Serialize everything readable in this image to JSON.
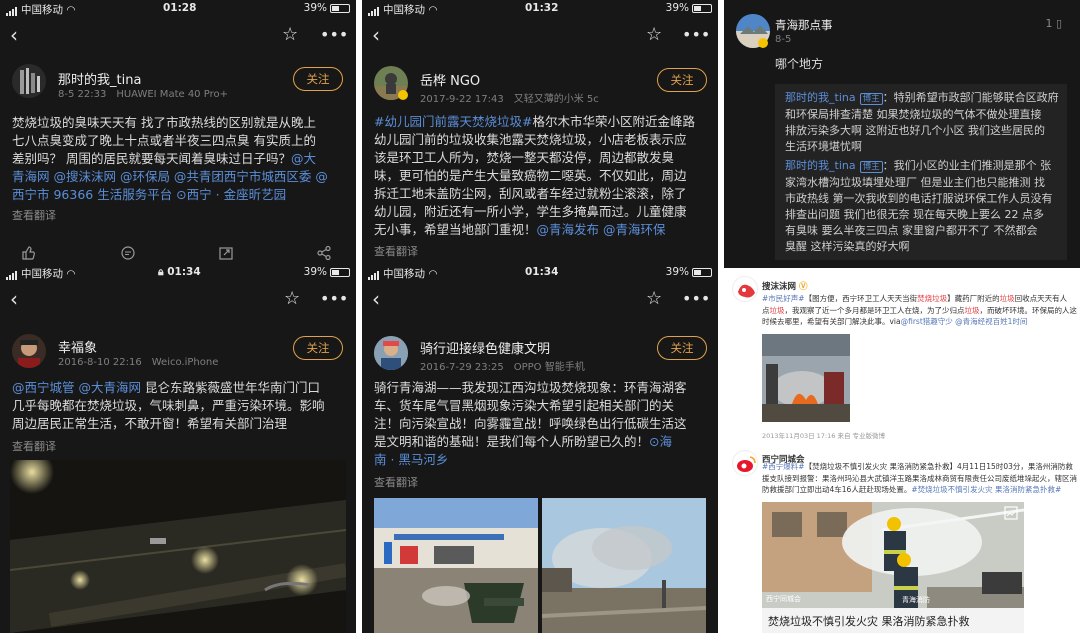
{
  "panel1": {
    "status": {
      "carrier": "中国移动",
      "time": "01:28",
      "battery": "39%"
    },
    "user": {
      "name": "那时的我_tina",
      "time": "8-5 22:33",
      "device": "HUAWEI Mate 40 Pro+"
    },
    "follow_label": "关注",
    "lines": [
      [
        {
          "t": "焚烧垃圾的臭味天天有 找了市政热线的区别就是从晚上"
        }
      ],
      [
        {
          "t": "七八点臭变成了晚上十点或者半夜三四点臭   有实质上的"
        }
      ],
      [
        {
          "t": "差别吗？ 周围的居民就要每天闻着臭味过日子吗？"
        },
        {
          "t": "@大",
          "link": true
        }
      ],
      [
        {
          "t": "青海网 @搜沫沫网 @环保局 @共青团西宁市城西区委 @",
          "link": true
        }
      ],
      [
        {
          "t": "西宁市 96366 生活服务平台 ⊙西宁 · 金座昕艺园",
          "link": true
        }
      ]
    ],
    "translate": "查看翻译"
  },
  "panel2": {
    "status": {
      "carrier": "中国移动",
      "time": "01:32",
      "battery": "39%"
    },
    "user": {
      "name": "岳桦 NGO",
      "time": "2017-9-22 17:43",
      "device": "又轻又薄的小米 5c"
    },
    "follow_label": "关注",
    "lines": [
      [
        {
          "t": "#幼儿园门前露天焚烧垃圾#",
          "link": true
        },
        {
          "t": "格尔木市华荣小区附近金峰路"
        }
      ],
      [
        {
          "t": "幼儿园门前的垃圾收集池露天焚烧垃圾，小店老板表示应"
        }
      ],
      [
        {
          "t": "该是环卫工人所为，焚烧一整天都没停，周边都散发臭"
        }
      ],
      [
        {
          "t": "味，更可怕的是产生大量致癌物二噁英。不仅如此，周边"
        }
      ],
      [
        {
          "t": "拆迁工地未盖防尘网，刮风或者车经过就粉尘滚滚，除了"
        }
      ],
      [
        {
          "t": "幼儿园，附近还有一所小学，学生多掩鼻而过。儿童健康"
        }
      ],
      [
        {
          "t": "无小事，希望当地部门重视！"
        },
        {
          "t": "@青海发布 @青海环保",
          "link": true
        }
      ]
    ],
    "translate": "查看翻译"
  },
  "panel3": {
    "user": {
      "name": "青海那点事",
      "date": "8-5"
    },
    "likes": "1",
    "question": "哪个地方",
    "replies": [
      {
        "author": "那时的我_tina",
        "badge": "博主",
        "lines": [
          "：特别希望市政部门能够联合区政府",
          "和环保局排查清楚  如果焚烧垃圾的气体不做处理直接",
          "排放污染多大啊  这附近也好几个小区  我们这些居民的",
          "生活环境堪忧啊"
        ]
      },
      {
        "author": "那时的我_tina",
        "badge": "博主",
        "lines": [
          "：我们小区的业主们推测是那个 张",
          "家湾水槽沟垃圾填埋处理厂   但是业主们也只能推测 找",
          "市政热线 第一次我收到的电话打服说环保工作人员没有",
          "排查出问题  我们也很无奈  现在每天晚上要么 22 点多",
          "有臭味 要么半夜三四点  家里窗户都开不了   不然都会",
          "臭醒 这样污染真的好大啊"
        ]
      }
    ]
  },
  "panel4": {
    "status": {
      "carrier": "中国移动",
      "time": "01:34",
      "battery": "39%"
    },
    "user": {
      "name": "幸福象",
      "time": "2016-8-10 22:16",
      "device": "Weico.iPhone"
    },
    "follow_label": "关注",
    "lines": [
      [
        {
          "t": "@西宁城管 @大青海网",
          "link": true
        },
        {
          "t": " 昆仑东路紫薇盛世年华南门门口"
        }
      ],
      [
        {
          "t": "几乎每晚都在焚烧垃圾，气味刺鼻，严重污染环境。影响"
        }
      ],
      [
        {
          "t": "周边居民正常生活，不敢开窗！希望有关部门治理"
        }
      ]
    ],
    "translate": "查看翻译"
  },
  "panel5": {
    "status": {
      "carrier": "中国移动",
      "time": "01:34",
      "battery": "39%"
    },
    "user": {
      "name": "骑行迎接绿色健康文明",
      "time": "2016-7-29 23:25",
      "device": "OPPO 智能手机"
    },
    "follow_label": "关注",
    "lines": [
      [
        {
          "t": "骑行青海湖——我发现江西沟垃圾焚烧现象：环青海湖客"
        }
      ],
      [
        {
          "t": "车、货车尾气冒黑烟现象污染大希望引起相关部门的关"
        }
      ],
      [
        {
          "t": "注！向污染宣战！向雾霾宣战！呼唤绿色出行低碳生活这"
        }
      ],
      [
        {
          "t": "是文明和谐的基础！是我们每个人所盼望已久的！"
        },
        {
          "t": "⊙海",
          "link": true
        }
      ],
      [
        {
          "t": "南 · 黑马河乡",
          "link": true
        }
      ]
    ],
    "translate": "查看翻译"
  },
  "panel6": {
    "post1": {
      "name": "搜沫沫网",
      "lines": [
        [
          {
            "t": "#市民好声#",
            "c": "blue"
          },
          {
            "t": "【图方便，西宁环卫工人天天当街"
          },
          {
            "t": "焚烧垃圾",
            "c": "red"
          },
          {
            "t": "】藏药厂附近的"
          },
          {
            "t": "垃圾",
            "c": "red"
          },
          {
            "t": "回收点天天有人"
          }
        ],
        [
          {
            "t": "点"
          },
          {
            "t": "垃圾",
            "c": "red"
          },
          {
            "t": "，我观察了近一个多月都是环卫工人在烧，为了少归点"
          },
          {
            "t": "垃圾",
            "c": "red"
          },
          {
            "t": "，而破坏环境。环保局的人这"
          }
        ],
        [
          {
            "t": "时候去哪里，希望有关部门解决此事。via"
          },
          {
            "t": "@first猎趣守少 @青海经视百姓1时间",
            "c": "blue"
          }
        ]
      ],
      "foot": "2013年11月03日 17:16  来自 专业版微博"
    },
    "post2": {
      "name": "西宁同城会",
      "lines": [
        [
          {
            "t": "#西宁爆料#",
            "c": "blue"
          },
          {
            "t": "【焚烧垃圾不慎引发火灾 果洛消防紧急扑救】4月11日15时03分，果洛州消防救"
          }
        ],
        [
          {
            "t": "援支队接到报警：果洛州玛沁县大武镇洋玉路果洛成林商贸有限责任公司废纸堆垛起火，辖区消"
          }
        ],
        [
          {
            "t": "防救援部门立即出动4车16人赶赴现场处置。"
          },
          {
            "t": "#焚烧垃圾不慎引发火灾 果洛消防紧急扑救#",
            "c": "blue"
          }
        ]
      ],
      "image_watermark": "西宁同城会",
      "image_caption": "焚烧垃圾不慎引发火灾 果洛消防紧急扑救"
    }
  },
  "colors": {
    "background": "#171717",
    "link": "#5b8fd9",
    "follow": "#e0a24a",
    "weibo_red": "#e4393c",
    "weibo_blue": "#5877b8"
  }
}
